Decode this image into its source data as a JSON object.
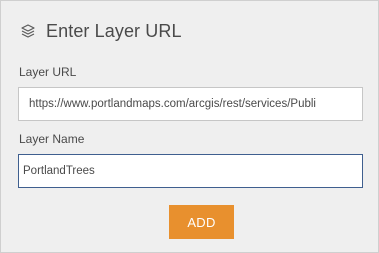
{
  "header": {
    "icon": "layers-icon",
    "title": "Enter Layer URL"
  },
  "form": {
    "url_label": "Layer URL",
    "url_value": "https://www.portlandmaps.com/arcgis/rest/services/Publi",
    "name_label": "Layer Name",
    "name_value": "PortlandTrees"
  },
  "actions": {
    "add_label": "ADD"
  },
  "colors": {
    "panel_bg": "#efefef",
    "accent": "#e8902e",
    "focus_border": "#3f5f8f"
  }
}
